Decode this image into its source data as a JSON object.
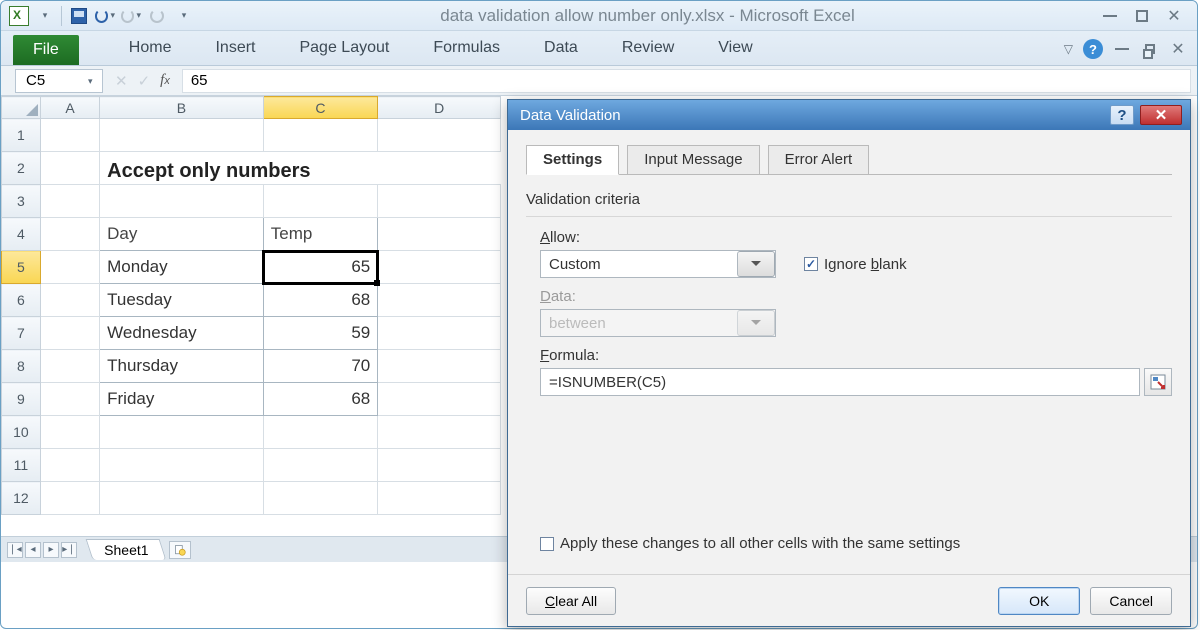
{
  "window_title": "data validation allow number only.xlsx  -  Microsoft Excel",
  "ribbon": {
    "file": "File",
    "tabs": [
      "Home",
      "Insert",
      "Page Layout",
      "Formulas",
      "Data",
      "Review",
      "View"
    ]
  },
  "namebox": "C5",
  "formula_bar": "65",
  "columns": [
    "A",
    "B",
    "C",
    "D"
  ],
  "row_numbers": [
    "1",
    "2",
    "3",
    "4",
    "5",
    "6",
    "7",
    "8",
    "9",
    "10",
    "11",
    "12"
  ],
  "sheet_title": "Accept only numbers",
  "table": {
    "headers": [
      "Day",
      "Temp"
    ],
    "rows": [
      [
        "Monday",
        "65"
      ],
      [
        "Tuesday",
        "68"
      ],
      [
        "Wednesday",
        "59"
      ],
      [
        "Thursday",
        "70"
      ],
      [
        "Friday",
        "68"
      ]
    ]
  },
  "sheet_tab": "Sheet1",
  "dialog": {
    "title": "Data Validation",
    "tabs": [
      "Settings",
      "Input Message",
      "Error Alert"
    ],
    "criteria_label": "Validation criteria",
    "allow_label": "Allow:",
    "allow_value": "Custom",
    "ignore_blank_label": "Ignore blank",
    "data_label": "Data:",
    "data_value": "between",
    "formula_label": "Formula:",
    "formula_value": "=ISNUMBER(C5)",
    "apply_label": "Apply these changes to all other cells with the same settings",
    "clear": "Clear All",
    "ok": "OK",
    "cancel": "Cancel"
  }
}
